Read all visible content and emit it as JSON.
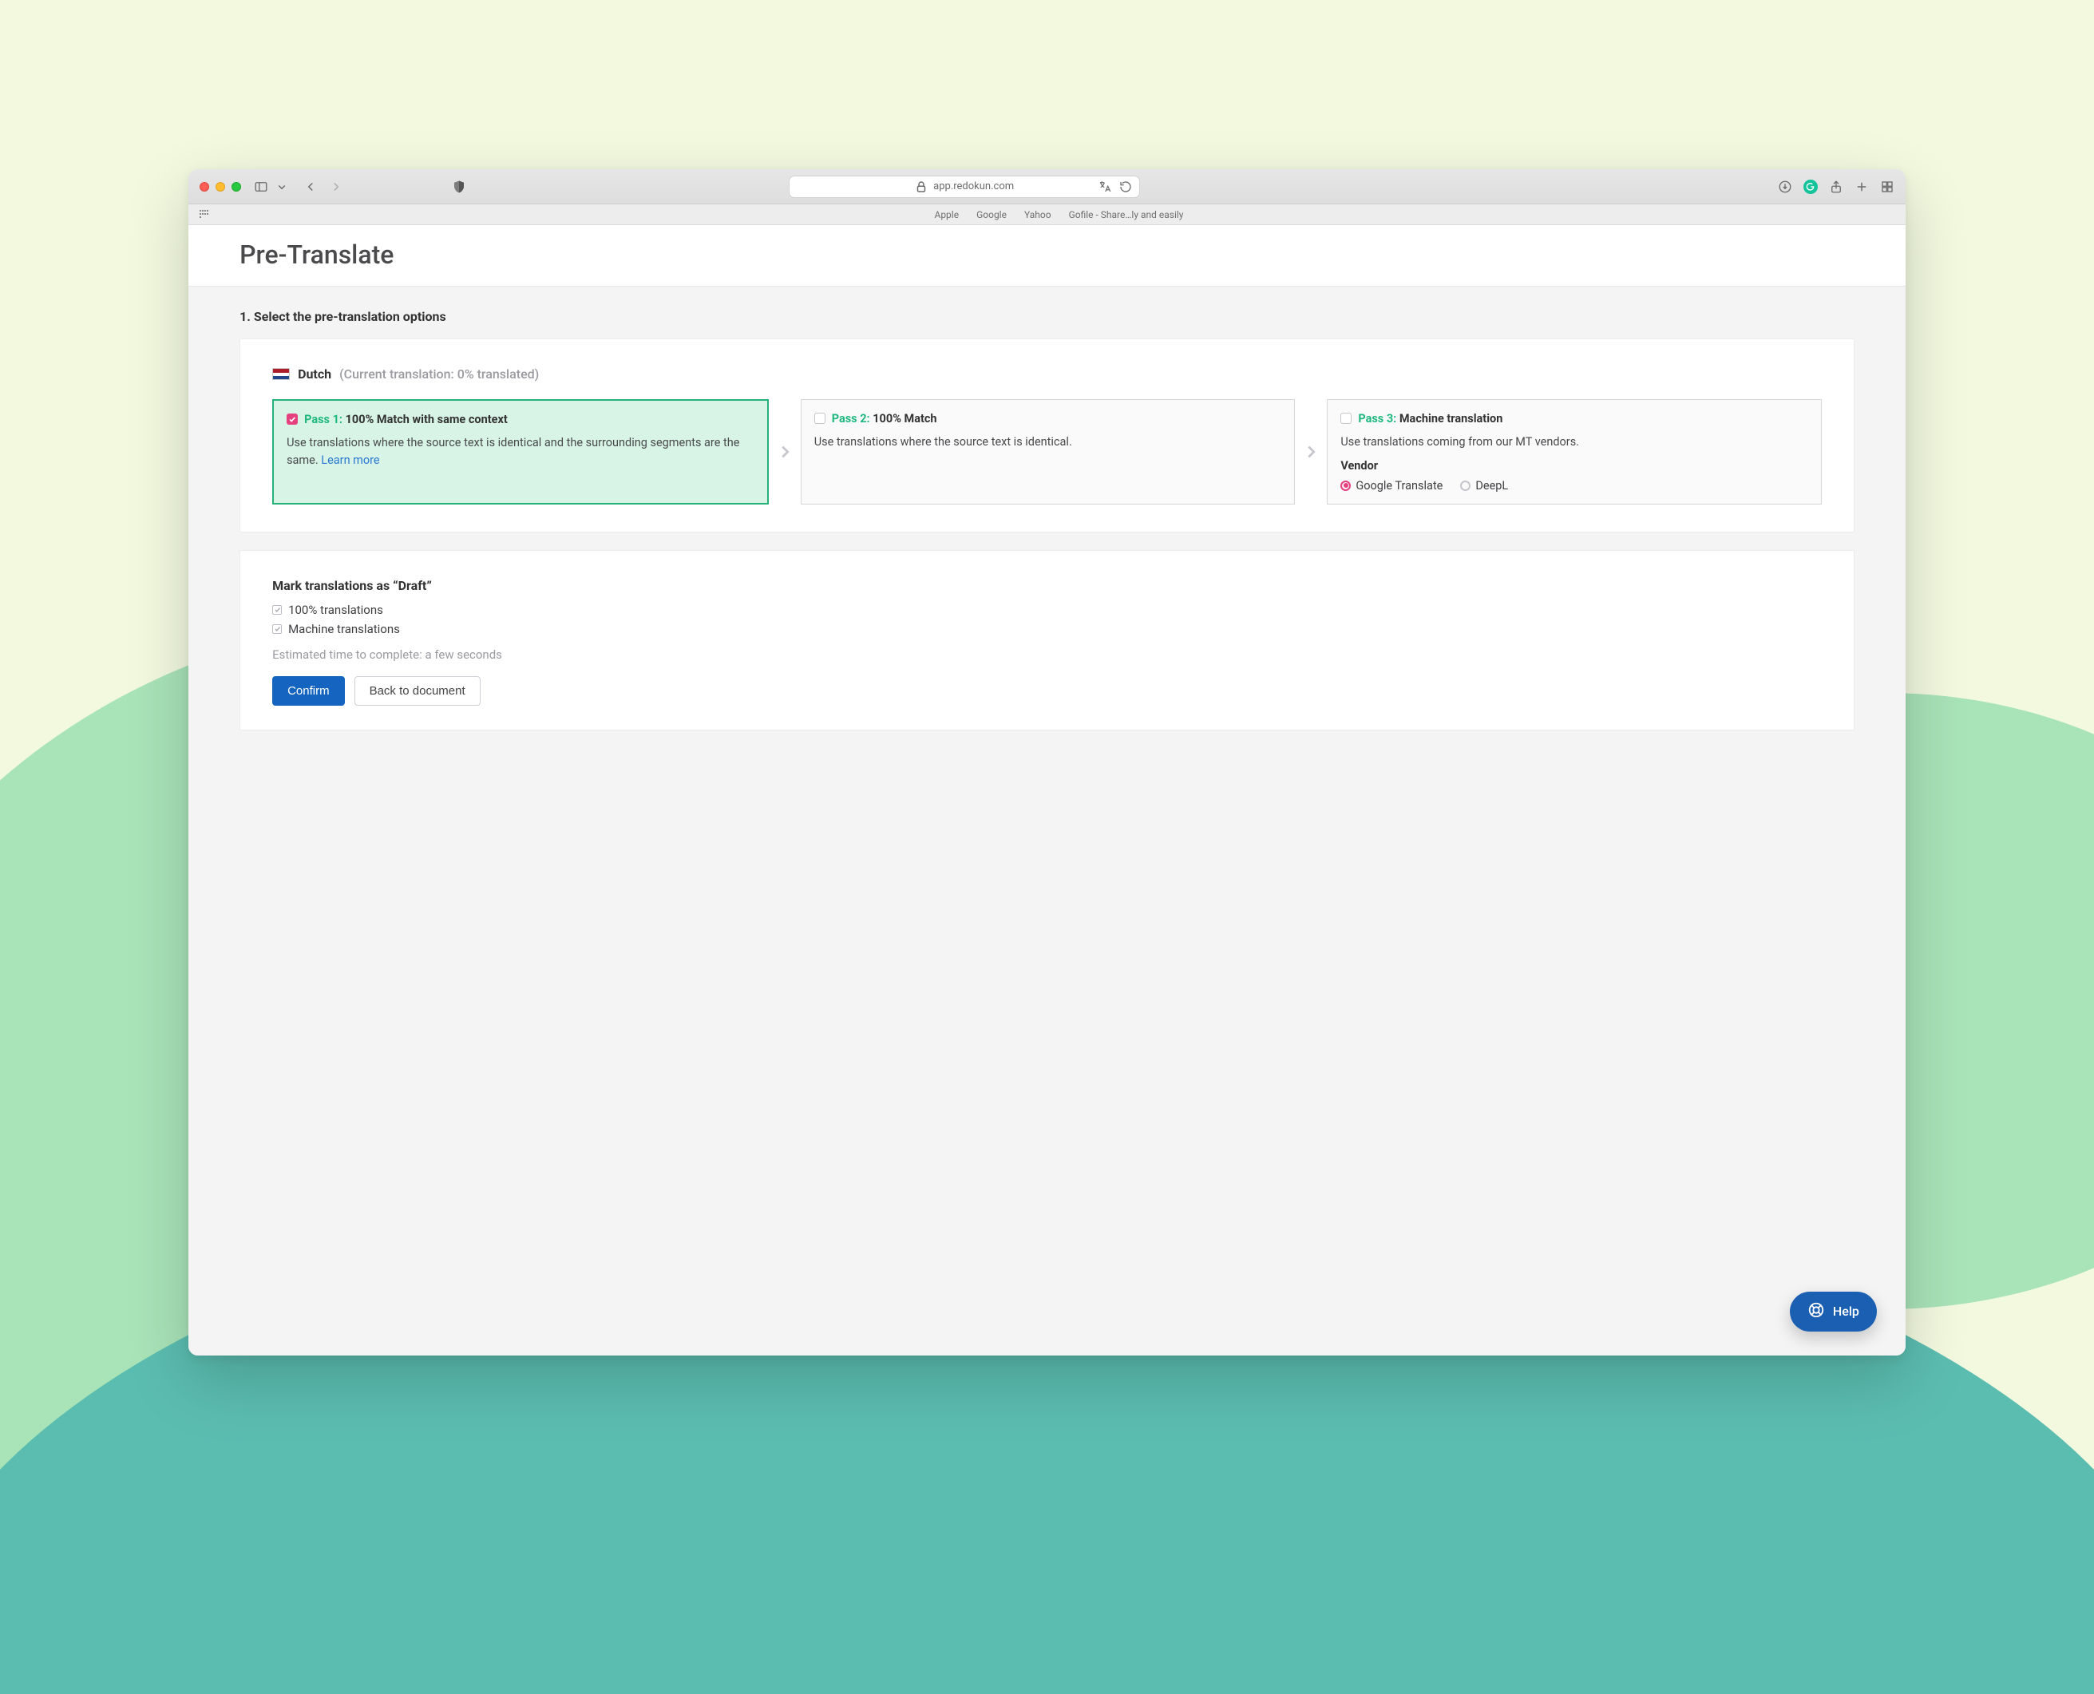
{
  "browser": {
    "url_host": "app.redokun.com",
    "bookmarks": [
      "Apple",
      "Google",
      "Yahoo",
      "Gofile - Share…ly and easily"
    ]
  },
  "page": {
    "title": "Pre-Translate",
    "step_heading": "1. Select the pre-translation options"
  },
  "language": {
    "name": "Dutch",
    "status": "(Current translation: 0% translated)"
  },
  "passes": {
    "p1": {
      "prefix": "Pass 1:",
      "title": "100% Match with same context",
      "desc": "Use translations where the source text is identical and the surrounding segments are the same. ",
      "learn": "Learn more",
      "checked": true
    },
    "p2": {
      "prefix": "Pass 2:",
      "title": "100% Match",
      "desc": "Use translations where the source text is identical.",
      "checked": false
    },
    "p3": {
      "prefix": "Pass 3:",
      "title": "Machine translation",
      "desc": "Use translations coming from our MT vendors.",
      "vendor_label": "Vendor",
      "vendors": {
        "google": "Google Translate",
        "deepl": "DeepL"
      },
      "selected_vendor": "google",
      "checked": false
    }
  },
  "draft": {
    "heading": "Mark translations as “Draft”",
    "opt1": "100% translations",
    "opt2": "Machine translations"
  },
  "eta": "Estimated time to complete: a few seconds",
  "buttons": {
    "confirm": "Confirm",
    "back": "Back to document"
  },
  "help": "Help"
}
